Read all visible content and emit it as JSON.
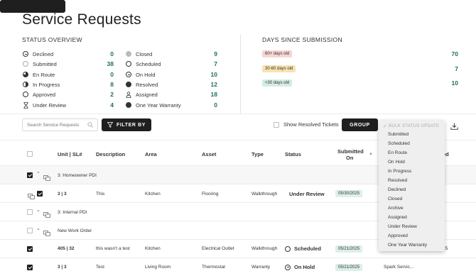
{
  "page": {
    "title": "Service Requests"
  },
  "status_overview": {
    "title": "STATUS OVERVIEW",
    "left": [
      {
        "label": "Declined",
        "count": "0",
        "icon": "circle-minus-icon"
      },
      {
        "label": "Submitted",
        "count": "38",
        "icon": "circle-outline-light-icon"
      },
      {
        "label": "En Route",
        "count": "0",
        "icon": "circle-three-quarter-icon"
      },
      {
        "label": "In Progress",
        "count": "8",
        "icon": "circle-half-icon"
      },
      {
        "label": "Approved",
        "count": "2",
        "icon": "circle-outline-icon"
      },
      {
        "label": "Under Review",
        "count": "4",
        "icon": "hourglass-icon"
      }
    ],
    "right": [
      {
        "label": "Closed",
        "count": "9",
        "icon": "circle-grey-icon"
      },
      {
        "label": "Scheduled",
        "count": "7",
        "icon": "circle-outline-icon"
      },
      {
        "label": "On Hold",
        "count": "10",
        "icon": "circle-minus-icon"
      },
      {
        "label": "Resolved",
        "count": "12",
        "icon": "circle-filled-icon"
      },
      {
        "label": "Assigned",
        "count": "18",
        "icon": "person-icon"
      },
      {
        "label": "One Year Warranty",
        "count": "0",
        "icon": "circle-filled-icon"
      }
    ]
  },
  "days_since": {
    "title": "DAYS SINCE SUBMISSION",
    "rows": [
      {
        "label": "60+ days old",
        "count": "70",
        "color": "#f8d5d2"
      },
      {
        "label": "30-60 days old",
        "count": "7",
        "color": "#f7e3b3"
      },
      {
        "label": "<30 days old",
        "count": "10",
        "color": "#d3ece6"
      }
    ]
  },
  "toolbar": {
    "search_placeholder": "Search Service Requests",
    "filter_label": "FILTER BY",
    "show_resolved_label": "Show Resolved Tickets",
    "group_label": "GROUP"
  },
  "table": {
    "headers": {
      "unit": "Unit | SL#",
      "description": "Description",
      "area": "Area",
      "asset": "Asset",
      "type": "Type",
      "status": "Status",
      "submitted_1": "Submitted",
      "submitted_2": "On",
      "assigned_tail": "ed"
    },
    "groups": [
      {
        "label": "3: Homeowner PDI"
      },
      {
        "label": "3: Internal PDI"
      },
      {
        "label": "New Work Order"
      }
    ],
    "rows": [
      {
        "unit": "3 | 3",
        "description": "This",
        "area": "Kitchen",
        "asset": "Flooring",
        "type": "Walkthrough",
        "status": "Under Review",
        "date": "05/30/2025",
        "assigned": ""
      },
      {
        "unit": "405 | 32",
        "description": "this wasn't a test",
        "area": "Kitchen",
        "asset": "Electrical Outlet",
        "type": "Walkthrough",
        "status": "Scheduled",
        "date": "05/21/2025",
        "assigned": "25"
      },
      {
        "unit": "3 | 3",
        "description": "Test",
        "area": "Living Room",
        "asset": "Thermostat",
        "type": "Warranty",
        "status": "On Hold",
        "date": "05/21/2025",
        "assigned": "Spark Servic..."
      }
    ]
  },
  "bulk_dropdown": {
    "header": "BULK STATUS UPDATE",
    "options": [
      "Submitted",
      "Scheduled",
      "En Route",
      "On Hold",
      "In Progress",
      "Resolved",
      "Declined",
      "Closed",
      "Archive",
      "Assigned",
      "Under Review",
      "Approved",
      "One Year Warranty"
    ]
  }
}
